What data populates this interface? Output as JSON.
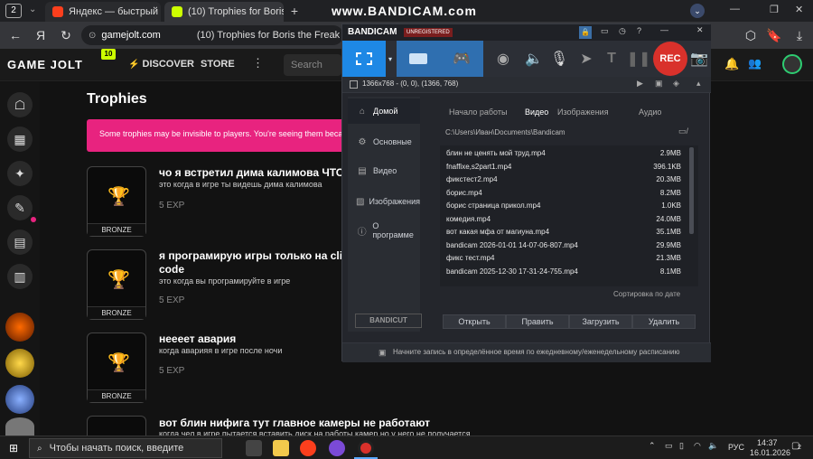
{
  "watermark": "www.BANDICAM.com",
  "browser": {
    "tab_count": "2",
    "tabs": [
      {
        "title": "Яндекс — быстрый поиск"
      },
      {
        "title": "(10) Trophies for Boris t"
      }
    ],
    "url": "gamejolt.com",
    "page_title": "(10) Trophies for Boris the Freak"
  },
  "gamejolt": {
    "logo": "GAME JOLT",
    "badge": "10",
    "nav": {
      "discover": "DISCOVER",
      "store": "STORE"
    },
    "search_placeholder": "Search"
  },
  "trophies": {
    "heading": "Trophies",
    "notice": "Some trophies may be invisible to players. You're seeing them because",
    "items": [
      {
        "title": "чо я встретил дима калимова ЧТО I",
        "desc": "это когда в игре ты видешь дима калимова",
        "exp": "5 EXP",
        "level": "BRONZE"
      },
      {
        "title": "я програмирую игры только на clic",
        "title2": "code",
        "desc": "это когда вы програмируйте в игре",
        "exp": "5 EXP",
        "level": "BRONZE"
      },
      {
        "title": "неееет авария",
        "desc": "когда аварияя в игре после ночи",
        "exp": "5 EXP",
        "level": "BRONZE"
      },
      {
        "title": "вот блин нифига тут главное камеры не работают",
        "desc": "когда чел в игре пытается вставить диск на работы камер но у него не получается"
      }
    ]
  },
  "bandicam": {
    "brand": "BANDICAM",
    "license": "UNREGISTERED",
    "rec": "REC",
    "resolution": "1366x768 - (0, 0), (1366, 768)",
    "sidebar": [
      "Домой",
      "Основные",
      "Видео",
      "Изображения",
      "О программе"
    ],
    "tabs": [
      "Начало работы",
      "Видео",
      "Изображения",
      "Аудио"
    ],
    "path": "C:\\Users\\Иван\\Documents\\Bandicam",
    "files": [
      {
        "name": "блин не ценять мой труд.mp4",
        "size": "2.9MB"
      },
      {
        "name": "fnaffixe,s2part1.mp4",
        "size": "396.1KB"
      },
      {
        "name": "фикстест2.mp4",
        "size": "20.3MB"
      },
      {
        "name": "борис.mp4",
        "size": "8.2MB"
      },
      {
        "name": "борис страница прикол.mp4",
        "size": "1.0KB"
      },
      {
        "name": "комедия.mp4",
        "size": "24.0MB"
      },
      {
        "name": "вот какая мфа от магиуна.mp4",
        "size": "35.1MB"
      },
      {
        "name": "bandicam 2026-01-01 14-07-06-807.mp4",
        "size": "29.9MB"
      },
      {
        "name": "фикс тест.mp4",
        "size": "21.3MB"
      },
      {
        "name": "bandicam 2025-12-30 17-31-24-755.mp4",
        "size": "8.1MB"
      }
    ],
    "sort": "Сортировка по дате",
    "bandicut": "BANDICUT",
    "actions": [
      "Открыть",
      "Править",
      "Загрузить",
      "Удалить"
    ],
    "footer": "Начните запись в определённое время по ежедневному/еженедельному расписанию"
  },
  "taskbar": {
    "search_placeholder": "Чтобы начать поиск, введите",
    "lang": "РУС",
    "time": "14:37",
    "date": "16.01.2026",
    "notif_count": "2"
  },
  "colors": {
    "accent_blue": "#1e88e5",
    "rec_red": "#d9312b",
    "notice_pink": "#e8237f",
    "gj_green": "#ccff00"
  }
}
